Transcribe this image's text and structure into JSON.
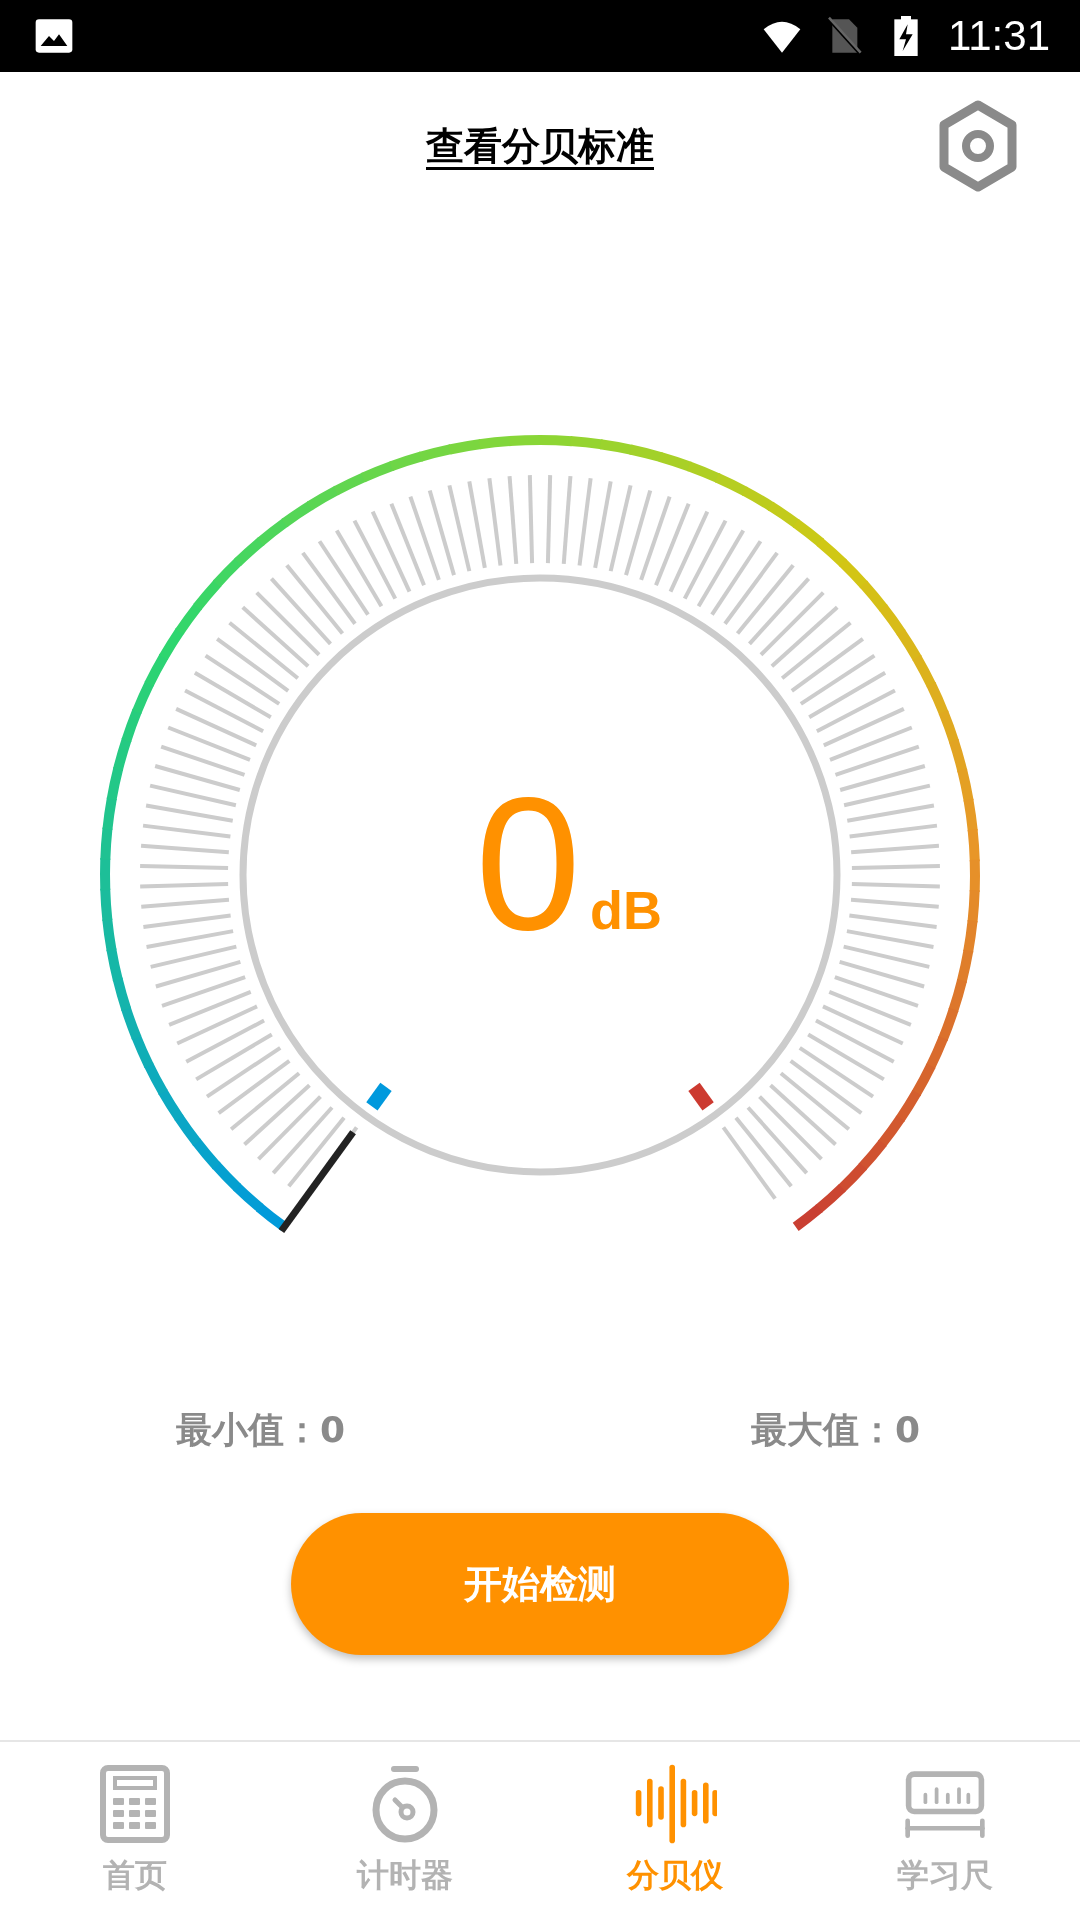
{
  "status_bar": {
    "time": "11:31"
  },
  "header": {
    "title": "查看分贝标准"
  },
  "gauge": {
    "reading": "0",
    "unit": "dB"
  },
  "stats": [
    {
      "label": "最小值：",
      "value": "0"
    },
    {
      "label": "最大值：",
      "value": "0"
    }
  ],
  "start_button": {
    "label": "开始检测"
  },
  "nav": [
    {
      "label": "首页",
      "kind": "calculator",
      "selected": false
    },
    {
      "label": "计时器",
      "kind": "stopwatch",
      "selected": false
    },
    {
      "label": "分贝仪",
      "kind": "wave",
      "selected": true
    },
    {
      "label": "学习尺",
      "kind": "ruler",
      "selected": false
    }
  ]
}
